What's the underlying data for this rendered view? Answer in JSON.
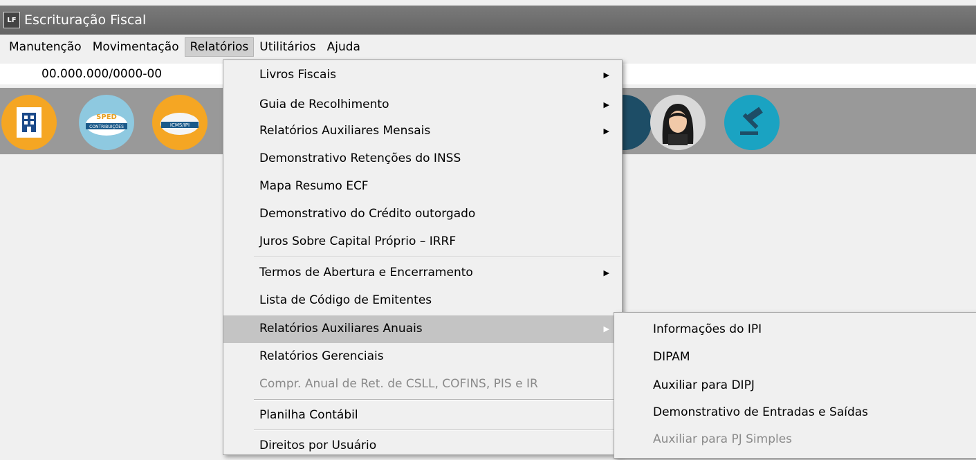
{
  "window": {
    "title": "Escrituração Fiscal",
    "logo": "LF"
  },
  "menubar": [
    "Manutenção",
    "Movimentação",
    "Relatórios",
    "Utilitários",
    "Ajuda"
  ],
  "company": {
    "cnpj": "00.000.000/0000-00"
  },
  "toolbar": {
    "icons": [
      "building-document-icon",
      "sped-contribuicoes-icon",
      "icms-ipi-icon",
      "dark-circle-icon",
      "woman-avatar-icon",
      "gavel-icon"
    ],
    "sped_title": "SPED",
    "sped_sub": "CONTRIBUIÇÕES",
    "icms_label": "ICMS/IPI"
  },
  "relatorios_menu": {
    "items": [
      "Livros Fiscais",
      "Guia de Recolhimento",
      "Relatórios Auxiliares Mensais",
      "Demonstrativo Retenções do INSS",
      "Mapa Resumo ECF",
      "Demonstrativo do Crédito outorgado",
      "Juros Sobre Capital Próprio – IRRF",
      "Termos de Abertura e Encerramento",
      "Lista de Código de Emitentes",
      "Relatórios Auxiliares Anuais",
      "Relatórios Gerenciais",
      "Compr. Anual de Ret. de CSLL, COFINS,  PIS e IR",
      "Planilha Contábil",
      "Direitos por Usuário"
    ]
  },
  "anuais_submenu": {
    "items": [
      "Informações do IPI",
      "DIPAM",
      "Auxiliar para DIPJ",
      "Demonstrativo de Entradas e Saídas",
      "Auxiliar para PJ Simples"
    ]
  }
}
